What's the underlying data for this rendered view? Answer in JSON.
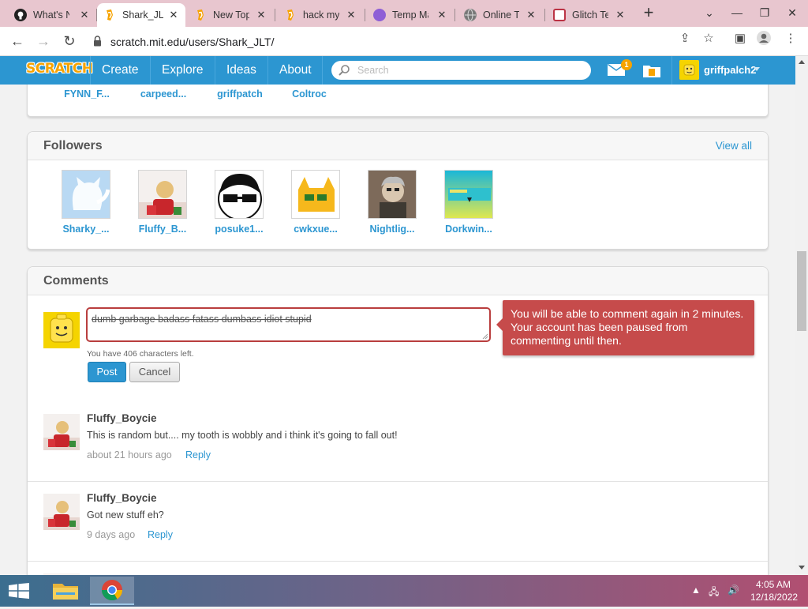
{
  "browser": {
    "tabs": [
      {
        "label": "What's New",
        "icon": "github-icon",
        "active": false
      },
      {
        "label": "Shark_JLT",
        "icon": "scratch-icon",
        "active": true
      },
      {
        "label": "New Topic",
        "icon": "scratch-icon",
        "active": false
      },
      {
        "label": "hack my",
        "icon": "scratch-icon",
        "active": false
      },
      {
        "label": "Temp Mail",
        "icon": "tempmail-icon",
        "active": false
      },
      {
        "label": "Online Text",
        "icon": "globe-icon",
        "active": false
      },
      {
        "label": "Glitch Text",
        "icon": "glitch-icon",
        "active": false
      }
    ],
    "new_tab": "+",
    "url": "scratch.mit.edu/users/Shark_JLT/"
  },
  "scratch_nav": {
    "logo": "SCRATCH",
    "links": [
      "Create",
      "Explore",
      "Ideas",
      "About"
    ],
    "search_placeholder": "Search",
    "message_count": "1",
    "username": "griffpalch2"
  },
  "following_top": {
    "users": [
      "FYNN_F...",
      "carpeed...",
      "griffpatch",
      "Coltroc"
    ]
  },
  "followers": {
    "title": "Followers",
    "view_all": "View all",
    "users": [
      "Sharky_...",
      "Fluffy_B...",
      "posuke1...",
      "cwkxue...",
      "Nightlig...",
      "Dorkwin..."
    ]
  },
  "comments": {
    "title": "Comments",
    "input_value": "dumb garbage badass fatass dumbass idiot stupid",
    "chars_left": "You have 406 characters left.",
    "post_label": "Post",
    "cancel_label": "Cancel",
    "error_message": "You will be able to comment again in 2 minutes. Your account has been paused from commenting until then.",
    "items": [
      {
        "author": "Fluffy_Boycie",
        "text": "This is random but.... my tooth is wobbly and i think it's going to fall out!",
        "time": "about 21 hours ago",
        "reply": "Reply"
      },
      {
        "author": "Fluffy_Boycie",
        "text": "Got new stuff eh?",
        "time": "9 days ago",
        "reply": "Reply"
      }
    ]
  },
  "taskbar": {
    "time": "4:05 AM",
    "date": "12/18/2022"
  },
  "colors": {
    "scratch_blue": "#2c96d1",
    "error_red": "#c64b4b",
    "tab_strip": "#e8c6cf"
  }
}
